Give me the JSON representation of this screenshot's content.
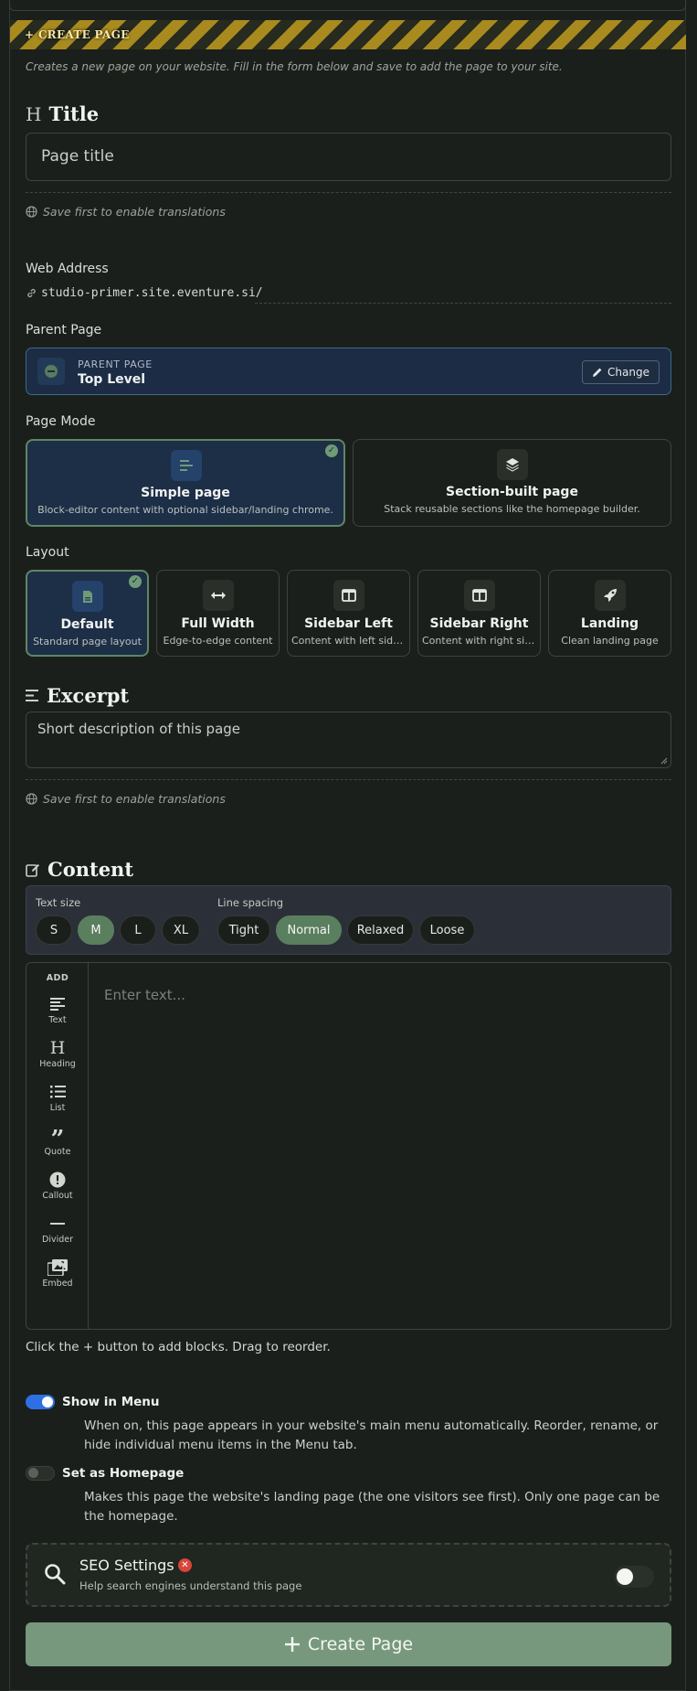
{
  "banner": {
    "label": "+ CREATE PAGE"
  },
  "description": "Creates a new page on your website. Fill in the form below and save to add the page to your site.",
  "title_section": {
    "heading": "Title",
    "input_placeholder": "Page title",
    "translation_hint": "Save first to enable translations"
  },
  "web_address": {
    "label": "Web Address",
    "url": "studio-primer.site.eventure.si/"
  },
  "parent_page": {
    "label": "Parent Page",
    "caption": "PARENT PAGE",
    "value": "Top Level",
    "change_label": "Change"
  },
  "page_mode": {
    "label": "Page Mode",
    "options": [
      {
        "title": "Simple page",
        "subtitle": "Block-editor content with optional sidebar/landing chrome.",
        "selected": true,
        "icon": "lines-icon"
      },
      {
        "title": "Section-built page",
        "subtitle": "Stack reusable sections like the homepage builder.",
        "selected": false,
        "icon": "layers-icon"
      }
    ]
  },
  "layout": {
    "label": "Layout",
    "options": [
      {
        "title": "Default",
        "subtitle": "Standard page layout",
        "selected": true,
        "icon": "file-icon"
      },
      {
        "title": "Full Width",
        "subtitle": "Edge-to-edge content",
        "selected": false,
        "icon": "arrows-horizontal-icon"
      },
      {
        "title": "Sidebar Left",
        "subtitle": "Content with left sidebar",
        "selected": false,
        "icon": "columns-icon"
      },
      {
        "title": "Sidebar Right",
        "subtitle": "Content with right sidebar",
        "selected": false,
        "icon": "columns-icon"
      },
      {
        "title": "Landing",
        "subtitle": "Clean landing page",
        "selected": false,
        "icon": "rocket-icon"
      }
    ]
  },
  "excerpt": {
    "heading": "Excerpt",
    "placeholder": "Short description of this page",
    "translation_hint": "Save first to enable translations"
  },
  "content": {
    "heading": "Content",
    "text_size_label": "Text size",
    "text_sizes": [
      "S",
      "M",
      "L",
      "XL"
    ],
    "text_size_selected": "M",
    "line_spacing_label": "Line spacing",
    "line_spacings": [
      "Tight",
      "Normal",
      "Relaxed",
      "Loose"
    ],
    "line_spacing_selected": "Normal",
    "palette_heading": "ADD",
    "palette": [
      "Text",
      "Heading",
      "List",
      "Quote",
      "Callout",
      "Divider",
      "Embed"
    ],
    "editor_placeholder": "Enter text...",
    "help": "Click the + button to add blocks. Drag to reorder."
  },
  "show_in_menu": {
    "label": "Show in Menu",
    "enabled": true,
    "description": "When on, this page appears in your website's main menu automatically. Reorder, rename, or hide individual menu items in the Menu tab."
  },
  "homepage": {
    "label": "Set as Homepage",
    "enabled": false,
    "description": "Makes this page the website's landing page (the one visitors see first). Only one page can be the homepage."
  },
  "seo": {
    "title": "SEO Settings",
    "subtitle": "Help search engines understand this page",
    "enabled": false
  },
  "submit": {
    "label": "Create Page"
  },
  "colors": {
    "accent": "#78987d",
    "selected_card": "#1d2e47",
    "toggle_on": "#2f6fe4",
    "error": "#d9453b"
  }
}
